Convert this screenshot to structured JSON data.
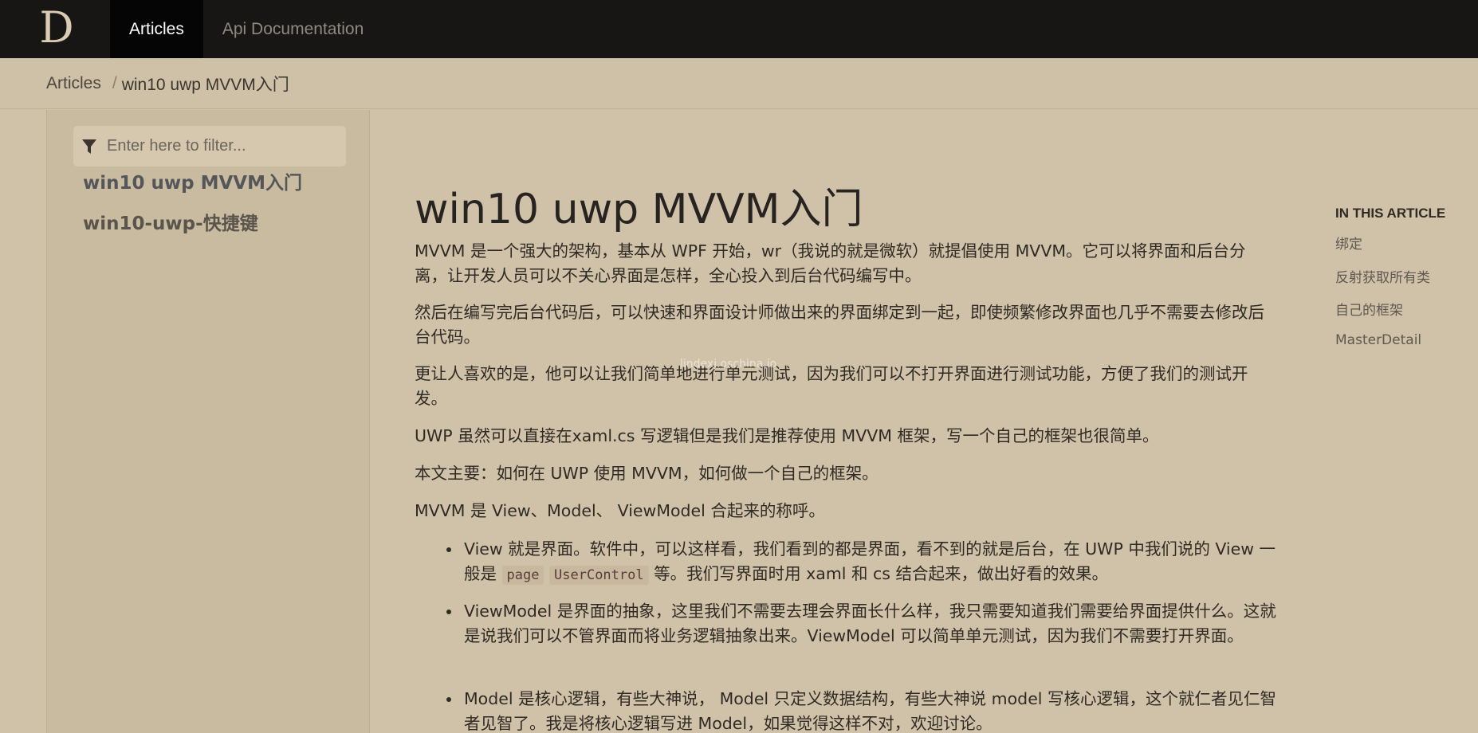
{
  "nav": {
    "logo": "D",
    "items": [
      {
        "label": "Articles",
        "active": true
      },
      {
        "label": "Api Documentation",
        "active": false
      }
    ]
  },
  "breadcrumb": {
    "root": "Articles",
    "separator": "/",
    "current": "win10 uwp MVVM入门"
  },
  "sidebar": {
    "filter_placeholder": "Enter here to filter...",
    "items": [
      {
        "label": "win10 uwp MVVM入门",
        "active": true
      },
      {
        "label": "win10-uwp-快捷键",
        "active": false
      }
    ]
  },
  "article": {
    "title": "win10 uwp MVVM入门",
    "paragraphs": [
      "MVVM 是一个强大的架构，基本从 WPF 开始，wr（我说的就是微软）就提倡使用 MVVM。它可以将界面和后台分离，让开发人员可以不关心界面是怎样，全心投入到后台代码编写中。",
      "然后在编写完后台代码后，可以快速和界面设计师做出来的界面绑定到一起，即使频繁修改界面也几乎不需要去修改后台代码。",
      "更让人喜欢的是，他可以让我们简单地进行单元测试，因为我们可以不打开界面进行测试功能，方便了我们的测试开发。",
      "UWP 虽然可以直接在xaml.cs 写逻辑但是我们是推荐使用 MVVM 框架，写一个自己的框架也很简单。",
      "本文主要：如何在 UWP 使用 MVVM，如何做一个自己的框架。",
      "MVVM 是 View、Model、 ViewModel 合起来的称呼。"
    ],
    "bullets": {
      "view_before": "View 就是界面。软件中，可以这样看，我们看到的都是界面，看不到的就是后台，在 UWP 中我们说的 View 一般是 ",
      "view_code1": "page",
      "view_code2": "UserControl",
      "view_after": " 等。我们写界面时用 xaml 和 cs 结合起来，做出好看的效果。",
      "viewmodel": "ViewModel 是界面的抽象，这里我们不需要去理会界面长什么样，我只需要知道我们需要给界面提供什么。这就是说我们可以不管界面而将业务逻辑抽象出来。ViewModel 可以简单单元测试，因为我们不需要打开界面。",
      "model": "Model 是核心逻辑，有些大神说， Model 只定义数据结构，有些大神说 model 写核心逻辑，这个就仁者见仁智者见智了。我是将核心逻辑写进 Model，如果觉得这样不对，欢迎讨论。"
    },
    "watermark": "lindexi.oschina.io"
  },
  "in_this_article": {
    "heading": "IN THIS ARTICLE",
    "links": [
      "绑定",
      "反射获取所有类",
      "自己的框架",
      "MasterDetail"
    ]
  }
}
